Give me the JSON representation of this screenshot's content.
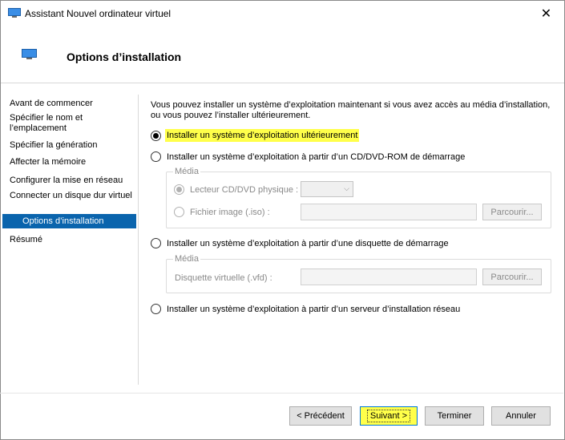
{
  "window": {
    "title": "Assistant Nouvel ordinateur virtuel"
  },
  "header": {
    "title": "Options d’installation"
  },
  "sidebar": {
    "items": [
      {
        "label": "Avant de commencer"
      },
      {
        "label": "Spécifier le nom et l’emplacement"
      },
      {
        "label": "Spécifier la génération"
      },
      {
        "label": "Affecter la mémoire"
      },
      {
        "label": "Configurer la mise en réseau"
      },
      {
        "label": "Connecter un disque dur virtuel"
      },
      {
        "label": "Options d’installation",
        "selected": true
      },
      {
        "label": "Résumé"
      }
    ]
  },
  "main": {
    "intro": "Vous pouvez installer un système d’exploitation maintenant si vous avez accès au média d’installation, ou vous pouvez l’installer ultérieurement.",
    "options": {
      "later": "Installer un système d’exploitation ultérieurement",
      "cd": "Installer un système d’exploitation à partir d’un CD/DVD-ROM de démarrage",
      "floppy": "Installer un système d’exploitation à partir d’une disquette de démarrage",
      "network": "Installer un système d’exploitation à partir d’un serveur d’installation réseau"
    },
    "cd_group": {
      "legend": "Média",
      "physical_drive_label": "Lecteur CD/DVD physique :",
      "physical_drive_value": "",
      "image_file_label": "Fichier image (.iso) :",
      "image_file_value": "",
      "browse_label": "Parcourir..."
    },
    "floppy_group": {
      "legend": "Média",
      "vfd_label": "Disquette virtuelle (.vfd) :",
      "vfd_value": "",
      "browse_label": "Parcourir..."
    },
    "selected_option": "later"
  },
  "footer": {
    "previous": "< Précédent",
    "next": "Suivant >",
    "finish": "Terminer",
    "cancel": "Annuler"
  },
  "colors": {
    "selection": "#0a64ad",
    "highlight": "#ffff4a"
  }
}
